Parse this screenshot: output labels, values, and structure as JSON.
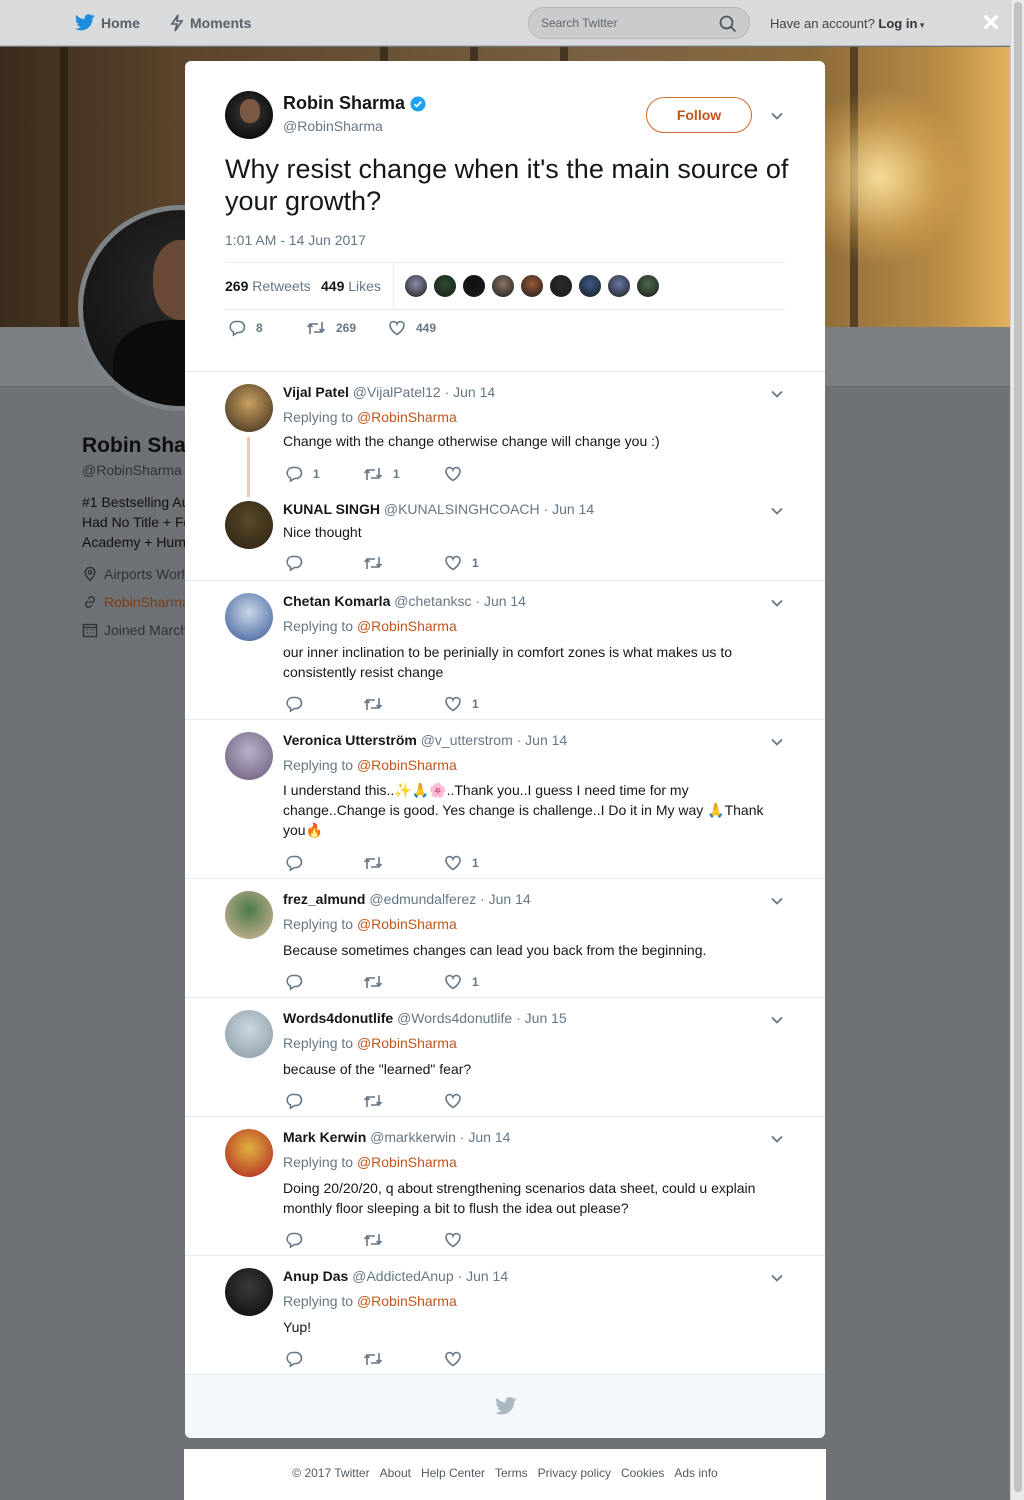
{
  "topnav": {
    "home": "Home",
    "moments": "Moments",
    "search_placeholder": "Search Twitter",
    "have_account": "Have an account?",
    "login": "Log in",
    "close": "×"
  },
  "background_profile": {
    "name": "Robin Sha",
    "handle": "@RobinSharma",
    "bio_lines": [
      "#1 Bestselling Au",
      "Had No Title + Fo",
      "Academy + Hum"
    ],
    "location": "Airports Worl",
    "website": "RobinSharma",
    "joined": "Joined March"
  },
  "tweet": {
    "author_name": "Robin Sharma",
    "author_handle": "@RobinSharma",
    "follow_label": "Follow",
    "text": "Why resist change when it's the main source of your growth?",
    "timestamp": "1:01 AM - 14 Jun 2017",
    "retweets_count": "269",
    "retweets_label": "Retweets",
    "likes_count": "449",
    "likes_label": "Likes",
    "liker_colors": [
      "#8a8fa8",
      "#2d4a2d",
      "#111111",
      "#8a7565",
      "#9a5a3a",
      "#2a2a2a",
      "#3a5a8a",
      "#6a7aa8",
      "#4a6a4a"
    ],
    "actions": {
      "replies": "8",
      "retweets": "269",
      "likes": "449"
    }
  },
  "replies": [
    {
      "name": "Vijal Patel",
      "handle": "@VijalPatel12",
      "date": "Jun 14",
      "replying_prefix": "Replying to",
      "replying_to": "@RobinSharma",
      "text": "Change with the change otherwise change will change you :)",
      "reply_count": "1",
      "retweet_count": "1",
      "like_count": "",
      "avatar_colors": [
        "#c8a060",
        "#3a2a1a"
      ]
    },
    {
      "name": "KUNAL SINGH",
      "handle": "@KUNALSINGHCOACH",
      "date": "Jun 14",
      "replying_prefix": "",
      "replying_to": "",
      "text": "Nice thought",
      "reply_count": "",
      "retweet_count": "",
      "like_count": "1",
      "avatar_colors": [
        "#5a4a2a",
        "#2a2010"
      ]
    },
    {
      "name": "Chetan Komarla",
      "handle": "@chetanksc",
      "date": "Jun 14",
      "replying_prefix": "Replying to",
      "replying_to": "@RobinSharma",
      "text": "our inner inclination to be perinially in comfort zones is what makes us to consistently resist change",
      "reply_count": "",
      "retweet_count": "",
      "like_count": "1",
      "avatar_colors": [
        "#c9d6e6",
        "#3a5a9a"
      ]
    },
    {
      "name": "Veronica Utterström",
      "handle": "@v_utterstrom",
      "date": "Jun 14",
      "replying_prefix": "Replying to",
      "replying_to": "@RobinSharma",
      "text": "I understand this..✨🙏🌸..Thank you..I guess I need time for my change..Change is good. Yes change is challenge..I Do it in My way 🙏Thank you🔥",
      "reply_count": "",
      "retweet_count": "",
      "like_count": "1",
      "avatar_colors": [
        "#b8b0c8",
        "#6a5a7a"
      ]
    },
    {
      "name": "frez_almund",
      "handle": "@edmundalferez",
      "date": "Jun 14",
      "replying_prefix": "Replying to",
      "replying_to": "@RobinSharma",
      "text": "Because sometimes changes can lead you back from the beginning.",
      "reply_count": "",
      "retweet_count": "",
      "like_count": "1",
      "avatar_colors": [
        "#4a7a4a",
        "#d9b89a"
      ]
    },
    {
      "name": "Words4donutlife",
      "handle": "@Words4donutlife",
      "date": "Jun 15",
      "replying_prefix": "Replying to",
      "replying_to": "@RobinSharma",
      "text": "because of the \"learned\" fear?",
      "reply_count": "",
      "retweet_count": "",
      "like_count": "",
      "avatar_colors": [
        "#ccd6dd",
        "#8899a6"
      ]
    },
    {
      "name": "Mark Kerwin",
      "handle": "@markkerwin",
      "date": "Jun 14",
      "replying_prefix": "Replying to",
      "replying_to": "@RobinSharma",
      "text": "Doing 20/20/20, q about strengthening scenarios data sheet, could u explain monthly floor sleeping a bit to flush the idea out please?",
      "reply_count": "",
      "retweet_count": "",
      "like_count": "",
      "avatar_colors": [
        "#e0b040",
        "#b02020"
      ]
    },
    {
      "name": "Anup Das",
      "handle": "@AddictedAnup",
      "date": "Jun 14",
      "replying_prefix": "Replying to",
      "replying_to": "@RobinSharma",
      "text": "Yup!",
      "reply_count": "",
      "retweet_count": "",
      "like_count": "",
      "avatar_colors": [
        "#3a3a3a",
        "#0a0a0a"
      ]
    }
  ],
  "footer": {
    "links": [
      "© 2017 Twitter",
      "About",
      "Help Center",
      "Terms",
      "Privacy policy",
      "Cookies",
      "Ads info"
    ]
  },
  "colors": {
    "accent": "#c0561c",
    "verified": "#1da1f2",
    "twitter_blue": "#1da1f2"
  }
}
